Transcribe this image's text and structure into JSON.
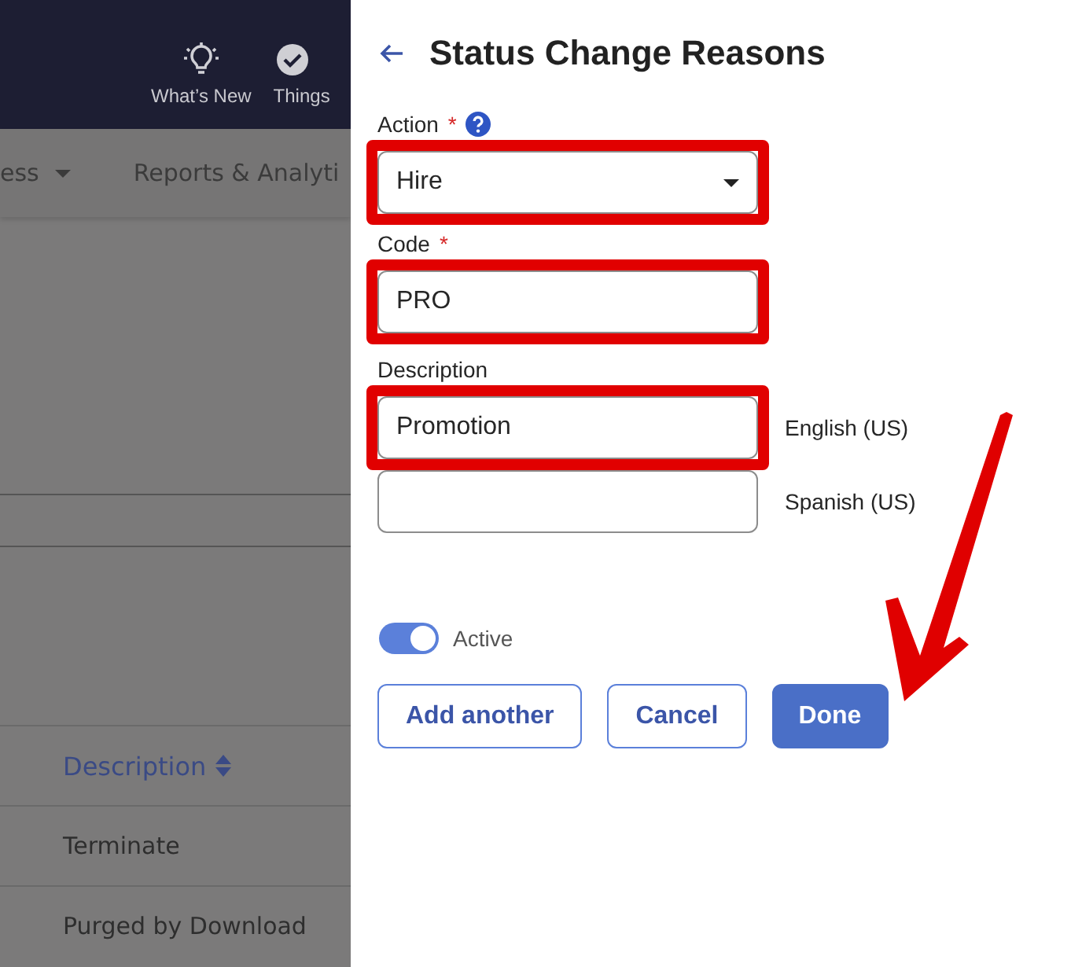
{
  "background_app": {
    "top_bar": {
      "items": [
        {
          "label": "What’s New"
        },
        {
          "label": "Things"
        }
      ]
    },
    "nav": {
      "items": [
        {
          "label": "ess",
          "dropdown": true
        },
        {
          "label": "Reports & Analyti",
          "dropdown": false
        }
      ]
    },
    "table": {
      "columns": [
        {
          "label": "Description",
          "sortable": true
        }
      ],
      "rows": [
        {
          "description": "Terminate"
        },
        {
          "description": "Purged by Download"
        }
      ]
    }
  },
  "panel": {
    "title": "Status Change Reasons",
    "action": {
      "label": "Action",
      "required_mark": "*",
      "help": true,
      "value": "Hire",
      "highlighted": true
    },
    "code": {
      "label": "Code",
      "required_mark": "*",
      "value": "PRO",
      "highlighted": true
    },
    "description": {
      "label": "Description",
      "fields": [
        {
          "value": "Promotion",
          "language": "English (US)",
          "highlighted": true
        },
        {
          "language": "Spanish (US)",
          "highlighted": false
        }
      ]
    },
    "active": {
      "label": "Active",
      "on": true
    },
    "buttons": [
      {
        "label": "Add another",
        "kind": "outline"
      },
      {
        "label": "Cancel",
        "kind": "outline"
      },
      {
        "label": "Done",
        "kind": "primary"
      }
    ],
    "pointer_arrow": true
  }
}
